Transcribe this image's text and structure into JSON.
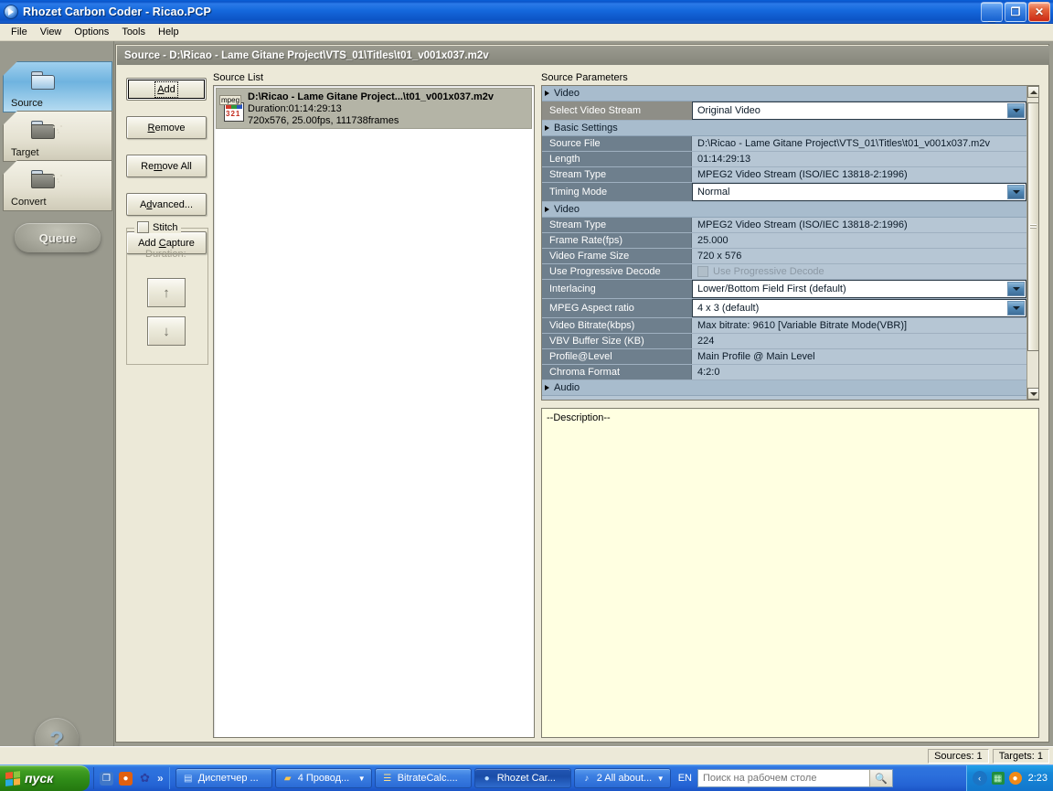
{
  "window": {
    "title": "Rhozet Carbon Coder  - Ricao.PCP",
    "icon": "app-media-icon",
    "buttons": {
      "minimize": "_",
      "maximize": "❐",
      "close": "✕"
    }
  },
  "menubar": {
    "items": [
      "File",
      "View",
      "Options",
      "Tools",
      "Help"
    ]
  },
  "nav": {
    "tabs": [
      {
        "label": "Source",
        "selected": true
      },
      {
        "label": "Target",
        "selected": false
      },
      {
        "label": "Convert",
        "selected": false
      }
    ],
    "queue_label": "Queue",
    "help_glyph": "?"
  },
  "panel": {
    "caption": "Source - D:\\Ricao - Lame Gitane Project\\VTS_01\\Titles\\t01_v001x037.m2v",
    "buttons": [
      {
        "pre": "",
        "accel": "A",
        "post": "dd",
        "focused": true
      },
      {
        "pre": "",
        "accel": "R",
        "post": "emove",
        "focused": false
      },
      {
        "pre": "Re",
        "accel": "m",
        "post": "ove All",
        "focused": false
      },
      {
        "pre": "A",
        "accel": "d",
        "post": "vanced...",
        "focused": false
      },
      {
        "pre": "Add ",
        "accel": "C",
        "post": "apture",
        "focused": false
      }
    ],
    "stitch": {
      "label": "Stitch",
      "checked": false,
      "duration_label": "Duration:",
      "up_glyph": "↑",
      "down_glyph": "↓"
    }
  },
  "source_list": {
    "label": "Source List",
    "items": [
      {
        "icon_tag": "mpeg",
        "icon_nums": "321",
        "title": "D:\\Ricao - Lame Gitane Project...\\t01_v001x037.m2v",
        "line2": "Duration:01:14:29:13",
        "line3": "720x576, 25.00fps, 111738frames",
        "selected": true
      }
    ]
  },
  "source_parameters": {
    "label": "Source Parameters",
    "rows": [
      {
        "kind": "category",
        "name": "Video"
      },
      {
        "kind": "edit",
        "name": "Select Video Stream",
        "value": "Original Video",
        "control": "combo",
        "selected": true
      },
      {
        "kind": "category",
        "name": "Basic Settings"
      },
      {
        "kind": "text",
        "name": "Source File",
        "value": "D:\\Ricao - Lame Gitane Project\\VTS_01\\Titles\\t01_v001x037.m2v"
      },
      {
        "kind": "text",
        "name": "Length",
        "value": "01:14:29:13"
      },
      {
        "kind": "text",
        "name": "Stream Type",
        "value": "MPEG2 Video Stream (ISO/IEC 13818-2:1996)"
      },
      {
        "kind": "edit",
        "name": "Timing Mode",
        "value": "Normal",
        "control": "combo"
      },
      {
        "kind": "category",
        "name": "Video"
      },
      {
        "kind": "text",
        "name": "Stream Type",
        "value": "MPEG2 Video Stream (ISO/IEC 13818-2:1996)"
      },
      {
        "kind": "text",
        "name": "Frame Rate(fps)",
        "value": "25.000"
      },
      {
        "kind": "text",
        "name": "Video Frame Size",
        "value": "720 x 576"
      },
      {
        "kind": "check-disabled",
        "name": "Use Progressive Decode",
        "value": "Use Progressive Decode"
      },
      {
        "kind": "edit",
        "name": "Interlacing",
        "value": "Lower/Bottom Field First (default)",
        "control": "combo"
      },
      {
        "kind": "edit",
        "name": "MPEG Aspect ratio",
        "value": "4 x 3 (default)",
        "control": "combo"
      },
      {
        "kind": "text",
        "name": "Video Bitrate(kbps)",
        "value": "Max bitrate: 9610 [Variable Bitrate Mode(VBR)]"
      },
      {
        "kind": "text",
        "name": "VBV Buffer Size (KB)",
        "value": "224"
      },
      {
        "kind": "text",
        "name": "Profile@Level",
        "value": "Main Profile @ Main Level"
      },
      {
        "kind": "text",
        "name": "Chroma Format",
        "value": "4:2:0"
      },
      {
        "kind": "category",
        "name": "Audio"
      }
    ]
  },
  "description": {
    "text": "--Description--"
  },
  "statusbar": {
    "panes": [
      "Sources: 1",
      "Targets: 1"
    ]
  },
  "taskbar": {
    "start_label": "пуск",
    "quicklaunch": [
      {
        "name": "show-desktop-icon",
        "glyph": "❐",
        "color": "#3f77c8"
      },
      {
        "name": "firefox-icon",
        "glyph": "●",
        "color": "#e06010"
      },
      {
        "name": "butterfly-icon",
        "glyph": "✿",
        "color": "#2a3fa0"
      }
    ],
    "quicklaunch_more": "»",
    "tasks": [
      {
        "label": "Диспетчер ...",
        "icon": "task-manager-icon",
        "glyph": "▤",
        "active": false,
        "dropdown": false
      },
      {
        "label": "4 Провод...",
        "icon": "folder-icon",
        "glyph": "▰",
        "active": false,
        "dropdown": true
      },
      {
        "label": "BitrateCalc....",
        "icon": "bitratecalc-icon",
        "glyph": "☰",
        "active": false,
        "dropdown": false
      },
      {
        "label": "Rhozet Car...",
        "icon": "rhozet-icon",
        "glyph": "●",
        "active": true,
        "dropdown": false
      },
      {
        "label": "2 All about...",
        "icon": "media-player-icon",
        "glyph": "♪",
        "active": false,
        "dropdown": true
      }
    ],
    "language": "EN",
    "search_placeholder": "Поиск на рабочем столе",
    "search_value": "",
    "search_icon": "magnifier-icon",
    "tray": {
      "chevron": "‹",
      "icons": [
        {
          "name": "network-icon",
          "glyph": "▦",
          "color": "#1f8e3f"
        },
        {
          "name": "updates-icon",
          "glyph": "●",
          "color": "#f08a18"
        }
      ],
      "clock": "2:23"
    }
  },
  "colors": {
    "titlebar_blue": "#1569dd",
    "panel_face": "#ece9d8",
    "desktop": "#9a9a8e",
    "grid_value_bg": "#b6c6d4",
    "grid_name_bg": "#6e7f8d",
    "selection_blue": "#6fb3df",
    "description_bg": "#ffffe1"
  }
}
